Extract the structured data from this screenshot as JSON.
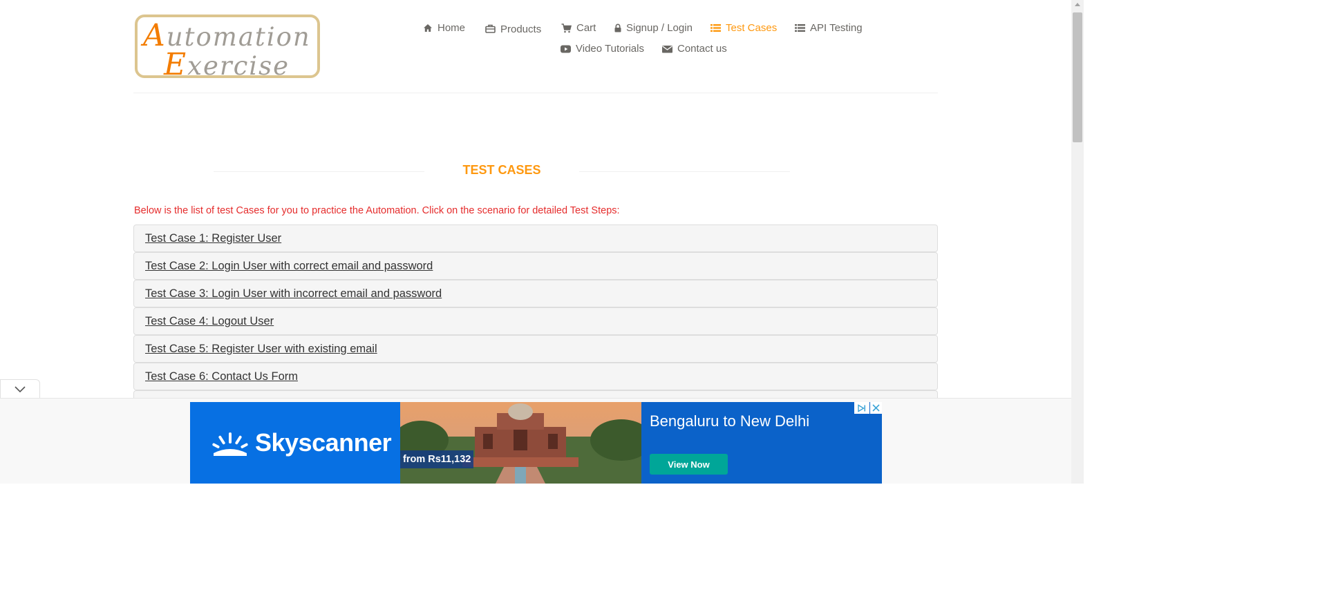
{
  "logo": {
    "line1_cap": "A",
    "line1_rest": "utomation",
    "line2_cap": "E",
    "line2_rest": "xercise"
  },
  "nav": {
    "home": "Home",
    "products": "Products",
    "cart": "Cart",
    "login": "Signup / Login",
    "test_cases": "Test Cases",
    "api_testing": "API Testing",
    "video": "Video Tutorials",
    "contact": "Contact us"
  },
  "colors": {
    "accent": "#fe980f",
    "intro_text": "#e52c2c",
    "link": "#333333",
    "row_bg": "#f5f5f5"
  },
  "page": {
    "title": "TEST CASES",
    "intro": "Below is the list of test Cases for you to practice the Automation. Click on the scenario for detailed Test Steps:"
  },
  "test_cases": [
    "Test Case 1: Register User",
    "Test Case 2: Login User with correct email and password",
    "Test Case 3: Login User with incorrect email and password",
    "Test Case 4: Logout User",
    "Test Case 5: Register User with existing email",
    "Test Case 6: Contact Us Form"
  ],
  "ad": {
    "brand": "Skyscanner",
    "price": "from Rs11,132",
    "headline": "Bengaluru to New Delhi",
    "cta": "View Now"
  }
}
